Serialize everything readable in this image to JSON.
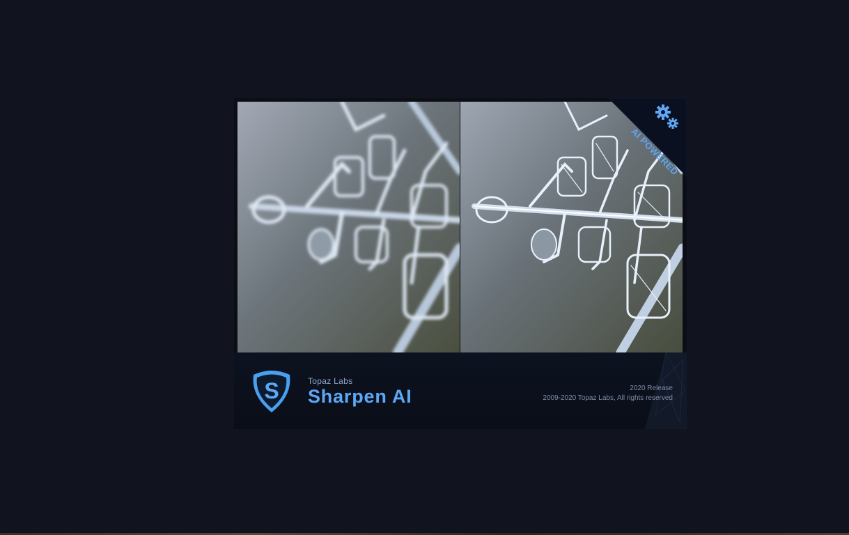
{
  "splash": {
    "ai_badge": {
      "text": "AI POWERED",
      "icon": "gears-icon"
    },
    "brand": "Topaz Labs",
    "product": "Sharpen AI",
    "release": "2020 Release",
    "copyright": "2009-2020 Topaz Labs, All rights reserved",
    "logo_icon": "topaz-s-logo-icon",
    "photo_before": "snowflake-photo-blurred",
    "photo_after": "snowflake-photo-sharpened"
  },
  "colors": {
    "desktop_bg": "#11141f",
    "accent": "#5ea7f5",
    "subtext": "#8ea8c8"
  }
}
